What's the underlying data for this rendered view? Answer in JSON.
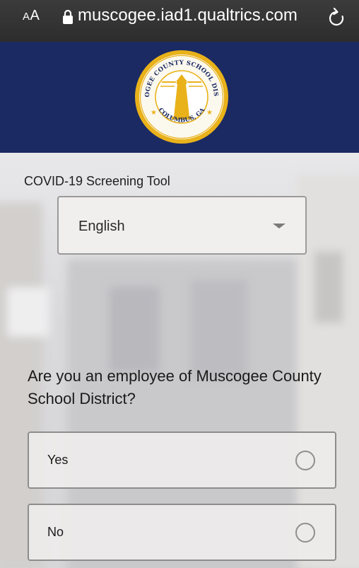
{
  "browser": {
    "text_size_label": "AA",
    "domain": "muscogee.iad1.qualtrics.com"
  },
  "header": {
    "seal": {
      "top_text": "MUSCOGEE COUNTY SCHOOL DISTRICT",
      "bottom_text": "COLUMBUS, GA"
    }
  },
  "survey": {
    "title": "COVID-19 Screening Tool",
    "language": {
      "selected": "English"
    },
    "question": "Are you an employee of Muscogee County School District?",
    "choices": [
      {
        "label": "Yes",
        "selected": false
      },
      {
        "label": "No",
        "selected": false
      }
    ]
  },
  "colors": {
    "header_bg": "#1b2a63",
    "seal_gold": "#e9b21a",
    "urlbar_bg": "#333333"
  }
}
